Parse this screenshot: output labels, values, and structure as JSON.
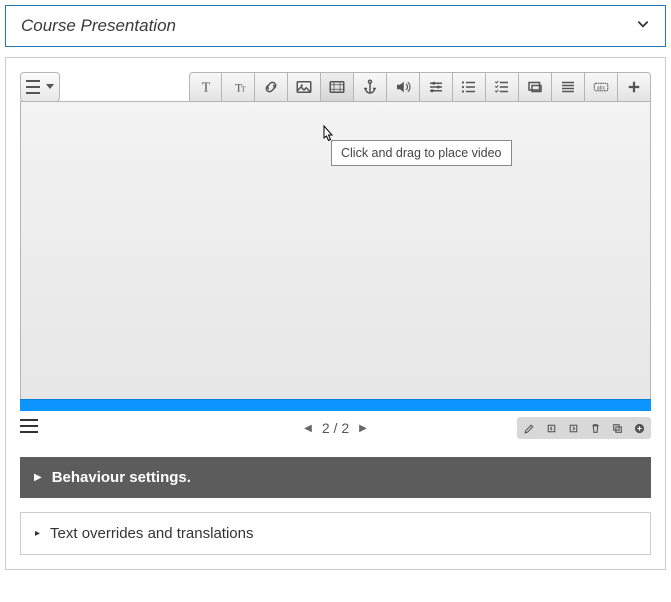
{
  "header": {
    "title": "Course Presentation"
  },
  "tooltip": "Click and drag to place video",
  "pager": {
    "text": "2 / 2"
  },
  "sections": {
    "behaviour": "Behaviour settings.",
    "overrides": "Text overrides and translations"
  }
}
